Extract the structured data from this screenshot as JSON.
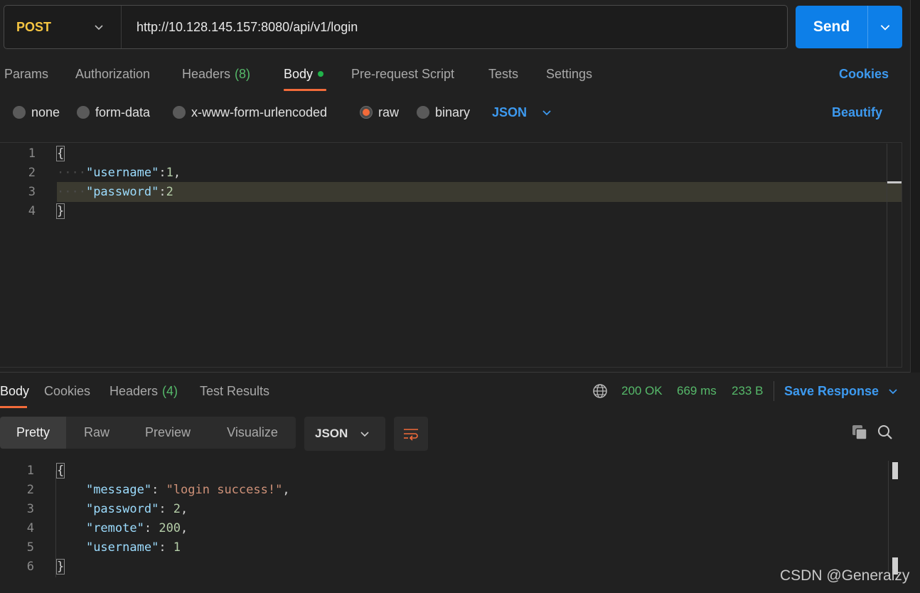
{
  "request": {
    "method": "POST",
    "url": "http://10.128.145.157:8080/api/v1/login",
    "send_label": "Send"
  },
  "request_tabs": [
    {
      "label": "Params"
    },
    {
      "label": "Authorization"
    },
    {
      "label": "Headers",
      "count": "(8)"
    },
    {
      "label": "Body",
      "active": true
    },
    {
      "label": "Pre-request Script"
    },
    {
      "label": "Tests"
    },
    {
      "label": "Settings"
    }
  ],
  "cookies_label": "Cookies",
  "body_types": [
    {
      "label": "none"
    },
    {
      "label": "form-data"
    },
    {
      "label": "x-www-form-urlencoded"
    },
    {
      "label": "raw",
      "selected": true
    },
    {
      "label": "binary"
    }
  ],
  "body_format": "JSON",
  "beautify_label": "Beautify",
  "request_body": {
    "line_numbers": [
      "1",
      "2",
      "3",
      "4"
    ],
    "open_brace": "{",
    "close_brace": "}",
    "username_key": "\"username\"",
    "username_value": "1",
    "password_key": "\"password\"",
    "password_value": "2"
  },
  "response_tabs": [
    {
      "label": "Body",
      "active": true
    },
    {
      "label": "Cookies"
    },
    {
      "label": "Headers",
      "count": "(4)"
    },
    {
      "label": "Test Results"
    }
  ],
  "response_status": {
    "code": "200 OK",
    "time": "669 ms",
    "size": "233 B"
  },
  "save_response_label": "Save Response",
  "view_modes": [
    {
      "label": "Pretty",
      "active": true
    },
    {
      "label": "Raw"
    },
    {
      "label": "Preview"
    },
    {
      "label": "Visualize"
    }
  ],
  "response_format": "JSON",
  "response_body": {
    "line_numbers": [
      "1",
      "2",
      "3",
      "4",
      "5",
      "6"
    ],
    "open_brace": "{",
    "close_brace": "}",
    "message_key": "\"message\"",
    "message_value": "\"login success!\"",
    "password_key": "\"password\"",
    "password_value": "2",
    "remote_key": "\"remote\"",
    "remote_value": "200",
    "username_key": "\"username\"",
    "username_value": "1"
  },
  "watermark": "CSDN @Generalzy",
  "colors": {
    "accent": "#0d7fe8",
    "link": "#3d9af0",
    "active_tab": "#f26b3a",
    "success": "#56b96a",
    "method": "#f5c542"
  }
}
